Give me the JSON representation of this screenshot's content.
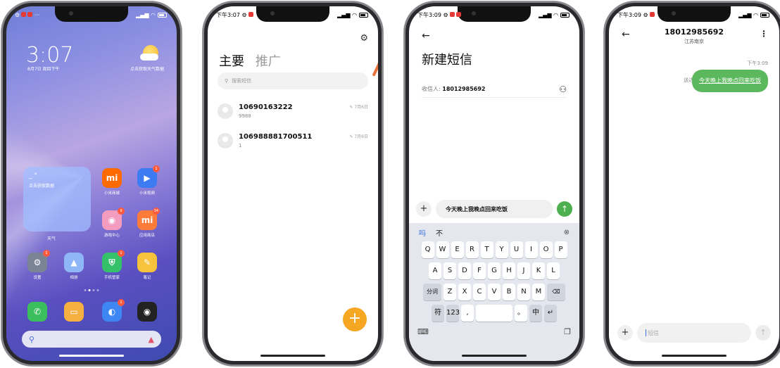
{
  "phone1": {
    "status_time": "",
    "clock": "3:07",
    "date": "8月7日 周四下午",
    "weather_hint": "点击获取天气数据",
    "widget_top": "_ °",
    "widget_text": "点击获取数据",
    "widget_label": "天气",
    "apps": [
      {
        "label": "小米商城",
        "glyph": "mi",
        "color": "#ff6a00",
        "badge": ""
      },
      {
        "label": "小米视频",
        "glyph": "▶",
        "color": "#3d7bf2",
        "badge": "1"
      },
      {
        "label": "游戏中心",
        "glyph": "◉",
        "color": "#f39cc0",
        "badge": "9"
      },
      {
        "label": "应用商店",
        "glyph": "mi",
        "color": "#ff7b3a",
        "badge": "34"
      },
      {
        "label": "设置",
        "glyph": "⚙",
        "color": "#7a8494",
        "badge": "1"
      },
      {
        "label": "相册",
        "glyph": "▲",
        "color": "#8fb6f7",
        "badge": ""
      },
      {
        "label": "手机管家",
        "glyph": "⛨",
        "color": "#35c06a",
        "badge": "1"
      },
      {
        "label": "笔记",
        "glyph": "✎",
        "color": "#f7c23c",
        "badge": ""
      }
    ],
    "dock": [
      {
        "glyph": "✆",
        "color": "#3bbf5e",
        "badge": ""
      },
      {
        "glyph": "▭",
        "color": "#f6b042",
        "badge": ""
      },
      {
        "glyph": "◐",
        "color": "#3f86f5",
        "badge": "1"
      },
      {
        "glyph": "◉",
        "color": "#222222",
        "badge": ""
      }
    ]
  },
  "phone2": {
    "status_time": "下午3:07",
    "tab_main": "主要",
    "tab_promo": "推广",
    "search_placeholder": "搜索短信",
    "messages": [
      {
        "number": "10690163222",
        "preview": "9988",
        "date": "7月6日"
      },
      {
        "number": "106988881700511",
        "preview": "1",
        "date": "7月6日"
      }
    ],
    "fab": "+"
  },
  "phone3": {
    "status_time": "下午3:09",
    "title": "新建短信",
    "recipient_label": "收信人:",
    "recipient_value": "18012985692",
    "draft": "今天晚上我晚点回来吃饭",
    "kb_top": [
      "吗",
      "不"
    ],
    "row1": [
      "Q",
      "W",
      "E",
      "R",
      "T",
      "Y",
      "U",
      "I",
      "O",
      "P"
    ],
    "row2": [
      "A",
      "S",
      "D",
      "F",
      "G",
      "H",
      "J",
      "K",
      "L"
    ],
    "row3_left": "分词",
    "row3": [
      "Z",
      "X",
      "C",
      "V",
      "B",
      "N",
      "M"
    ],
    "row4": [
      "符",
      "123",
      ",",
      "",
      "。",
      "中"
    ]
  },
  "phone4": {
    "status_time": "下午3:09",
    "contact": "18012985692",
    "location": "江苏南京",
    "time": "下午3:09",
    "sent_label": "送达",
    "bubble": "今天晚上我晚点回来吃饭",
    "input_placeholder": "短信"
  }
}
